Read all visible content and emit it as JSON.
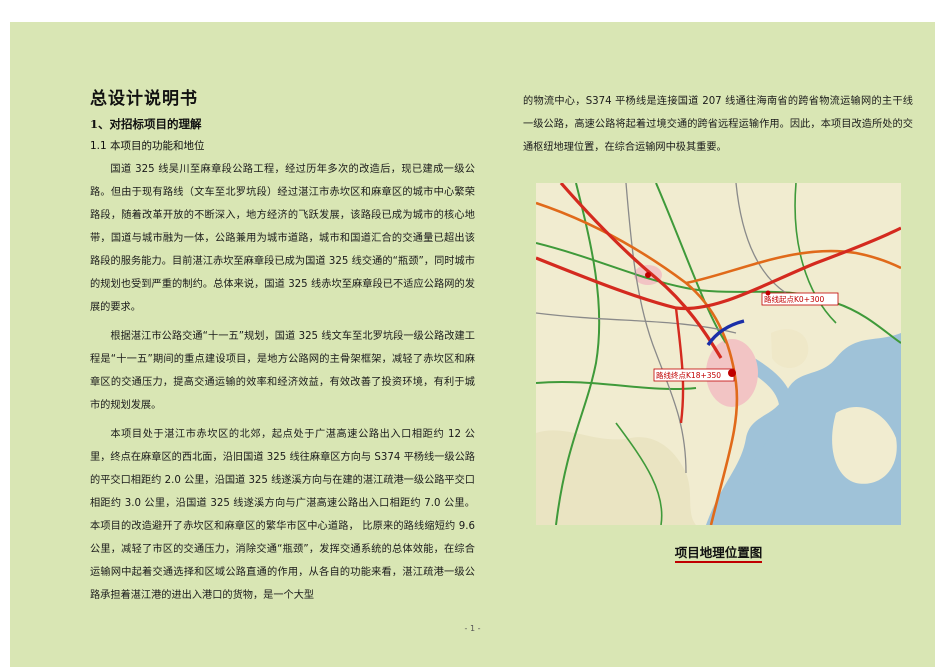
{
  "document": {
    "title": "总设计说明书",
    "section_heading": "1、对招标项目的理解",
    "sub_heading": "1.1 本项目的功能和地位",
    "left_paragraphs": [
      "国道 325 线吴川至麻章段公路工程，经过历年多次的改造后，现已建成一级公路。但由于现有路线（文车至北罗坑段）经过湛江市赤坎区和麻章区的城市中心繁荣路段，随着改革开放的不断深入，地方经济的飞跃发展，该路段已成为城市的核心地带，国道与城市融为一体，公路兼用为城市道路，城市和国道汇合的交通量已超出该路段的服务能力。目前湛江赤坎至麻章段已成为国道 325 线交通的“瓶颈”，同时城市的规划也受到严重的制约。总体来说，国道 325 线赤坎至麻章段已不适应公路网的发展的要求。",
      "根据湛江市公路交通“十一五”规划，国道 325 线文车至北罗坑段一级公路改建工程是“十一五”期间的重点建设项目，是地方公路网的主骨架框架，减轻了赤坎区和麻章区的交通压力，提高交通运输的效率和经济效益，有效改善了投资环境，有利于城市的规划发展。",
      "本项目处于湛江市赤坎区的北郊，起点处于广湛高速公路出入口相距约 12 公里，终点在麻章区的西北面，沿旧国道 325 线往麻章区方向与 S374 平杨线一级公路的平交口相距约 2.0 公里，沿国道 325 线遂溪方向与在建的湛江疏港一级公路平交口相距约 3.0 公里，沿国道 325 线遂溪方向与广湛高速公路出入口相距约 7.0 公里。本项目的改造避开了赤坎区和麻章区的繁华市区中心道路， 比原来的路线缩短约 9.6 公里，减轻了市区的交通压力，消除交通“瓶颈”，发挥交通系统的总体效能，在综合运输网中起着交通选择和区域公路直通的作用，从各自的功能来看，湛江疏港一级公路承担着湛江港的进出入港口的货物，是一个大型"
    ],
    "right_paragraph": "的物流中心，S374 平杨线是连接国道 207 线通往海南省的跨省物流运输网的主干线一级公路，高速公路将起着过境交通的跨省远程运输作用。因此，本项目改造所处的交通枢纽地理位置，在综合运输网中极其重要。",
    "map_caption": "项目地理位置图",
    "page_number": "- 1 -"
  },
  "map": {
    "labels": {
      "end_point": "路线起点K0+300",
      "start_point": "路线终点K18+350"
    },
    "colors": {
      "land": "#f1ecd0",
      "sea": "#9fc2d8",
      "expressway": "#d42a1f",
      "national_road": "#e06a1a",
      "project_route": "#1b2fa8",
      "provincial_road": "#3f9a3a",
      "city": "#f2c4c4"
    }
  }
}
